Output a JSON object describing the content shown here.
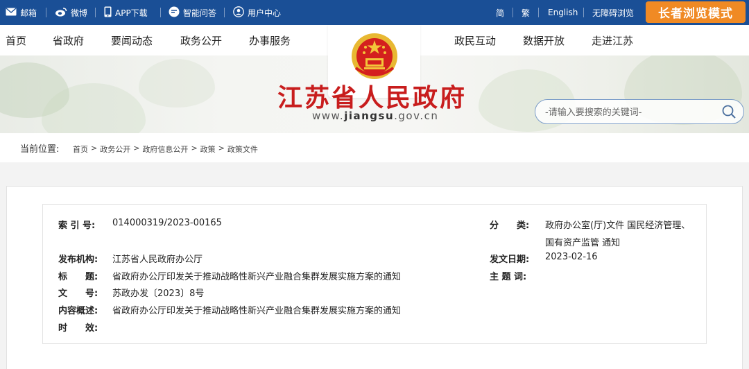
{
  "topbar": {
    "mail": "邮箱",
    "weibo": "微博",
    "app": "APP下载",
    "qa": "智能问答",
    "user": "用户中心",
    "lang_simplified": "简",
    "lang_traditional": "繁",
    "lang_english": "English",
    "accessible": "无障碍浏览",
    "elder_mode": "长者浏览模式"
  },
  "nav": {
    "home": "首页",
    "gov": "省政府",
    "news": "要闻动态",
    "open": "政务公开",
    "service": "办事服务",
    "interact": "政民互动",
    "data": "数据开放",
    "about": "走进江苏"
  },
  "banner": {
    "title": "江苏省人民政府",
    "domain_prefix": "www.",
    "domain_main": "jiangsu",
    "domain_suffix": ".gov.cn",
    "search_placeholder": "-请输入要搜索的关键词-"
  },
  "breadcrumb": {
    "label": "当前位置:",
    "items": [
      "首页",
      "政务公开",
      "政府信息公开",
      "政策",
      "政策文件"
    ],
    "separator": ">"
  },
  "info": {
    "index_label": "索 引 号:",
    "index_value": "014000319/2023-00165",
    "category_label": "分　　类:",
    "category_value_1": "政府办公室(厅)文件 国民经济管理、",
    "category_value_2": "国有资产监管 通知",
    "issuer_label": "发布机构:",
    "issuer_value": "江苏省人民政府办公厅",
    "date_label": "发文日期:",
    "date_value": "2023-02-16",
    "title_label": "标　　题:",
    "title_value": "省政府办公厅印发关于推动战略性新兴产业融合集群发展实施方案的通知",
    "subject_label": "主 题 词:",
    "subject_value": "",
    "docno_label": "文　　号:",
    "docno_value": "苏政办发〔2023〕8号",
    "summary_label": "内容概述:",
    "summary_value": "省政府办公厅印发关于推动战略性新兴产业融合集群发展实施方案的通知",
    "validity_label": "时　　效:",
    "validity_value": ""
  },
  "colors": {
    "topbar": "#1a4f96",
    "elder": "#f08a24",
    "title": "#c81d1d",
    "search_border": "#7a9cc8"
  }
}
